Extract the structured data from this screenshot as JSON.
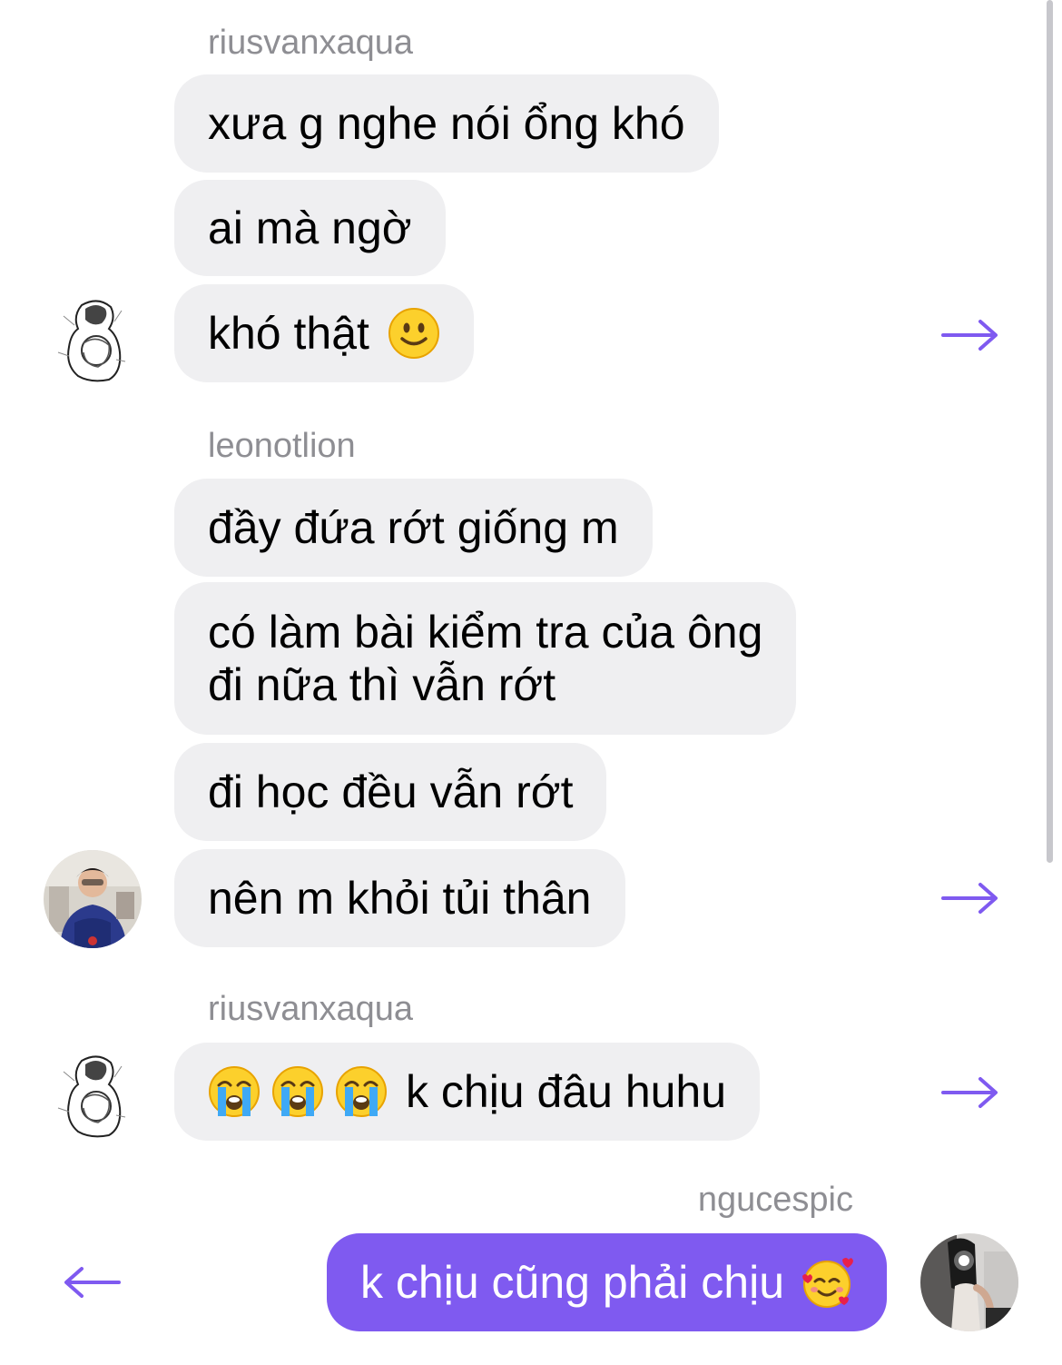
{
  "colors": {
    "accent": "#7f5af0",
    "incoming_bubble": "#efeff1",
    "sender_name": "#8e8e93"
  },
  "messages": [
    {
      "sender": "riusvanxaqua",
      "text": "xưa g nghe nói ổng khó"
    },
    {
      "text": "ai mà ngờ"
    },
    {
      "text": "khó thật",
      "emoji": "slightly-smiling-face"
    },
    {
      "sender": "leonotlion",
      "text": "đầy đứa rớt giống m"
    },
    {
      "lines": [
        "có làm bài kiểm tra của ông",
        "đi nữa thì vẫn rớt"
      ]
    },
    {
      "text": "đi học đều vẫn rớt"
    },
    {
      "text": "nên m khỏi tủi thân"
    },
    {
      "sender": "riusvanxaqua",
      "text": "k chịu đâu huhu",
      "emoji": "loudly-crying-face x3"
    },
    {
      "sender": "ngucespic",
      "text": "k chịu cũng phải chịu",
      "emoji": "smiling-face-with-hearts"
    }
  ],
  "icons": {
    "forward": "right-arrow-icon",
    "reply": "left-arrow-icon"
  }
}
